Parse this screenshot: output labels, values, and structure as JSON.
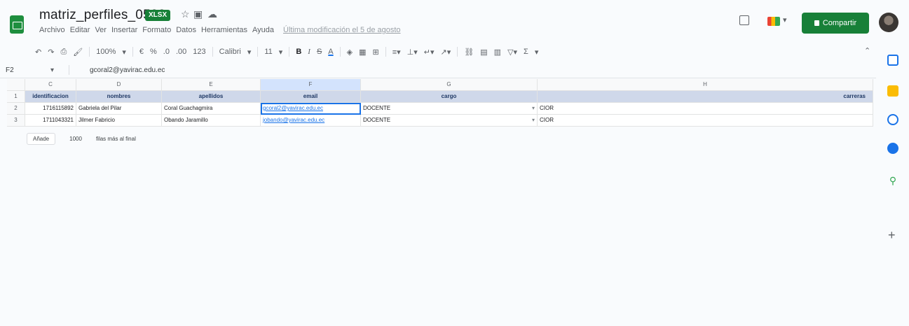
{
  "header": {
    "title": "matriz_perfiles_0508",
    "badge": "XLSX",
    "menu": [
      "Archivo",
      "Editar",
      "Ver",
      "Insertar",
      "Formato",
      "Datos",
      "Herramientas",
      "Ayuda"
    ],
    "last_edit": "Última modificación el 5 de agosto",
    "share_label": "Compartir"
  },
  "toolbar": {
    "zoom": "100%",
    "currency": "€",
    "percent": "%",
    "decimals_less": ".0",
    "decimals_more": ".00",
    "format_more": "123",
    "font": "Calibri",
    "font_size": "11",
    "bold": "B",
    "italic": "I",
    "strike": "S",
    "text_color": "A",
    "sum": "Σ"
  },
  "formula_bar": {
    "namebox": "F2",
    "value": "gcoral2@yavirac.edu.ec"
  },
  "grid": {
    "columns": [
      "C",
      "D",
      "E",
      "F",
      "G",
      "H"
    ],
    "selected_column": "F",
    "rows": [
      {
        "row": "1",
        "cells": [
          "identificacion",
          "nombres",
          "apellidos",
          "email",
          "cargo",
          "carreras"
        ]
      },
      {
        "row": "2",
        "cells": [
          "1716115892",
          "Gabriela del Pilar",
          "Coral Guachagmira",
          "gcoral2@yavirac.edu.ec",
          "DOCENTE",
          "CIOR"
        ]
      },
      {
        "row": "3",
        "cells": [
          "1711043321",
          "Jilmer Fabricio",
          "Obando Jaramillo",
          "jobando@yavirac.edu.ec",
          "DOCENTE",
          "CIOR"
        ]
      }
    ]
  },
  "add_rows": {
    "button": "Añade",
    "count": "1000",
    "label": "filas más al final"
  },
  "colors": {
    "brand_green": "#188038",
    "header_fill": "#cfd8ea",
    "selection_blue": "#1a73e8"
  },
  "side_panel_icons": [
    "calendar-icon",
    "keep-icon",
    "tasks-icon",
    "contacts-icon",
    "maps-icon",
    "plus-icon"
  ]
}
